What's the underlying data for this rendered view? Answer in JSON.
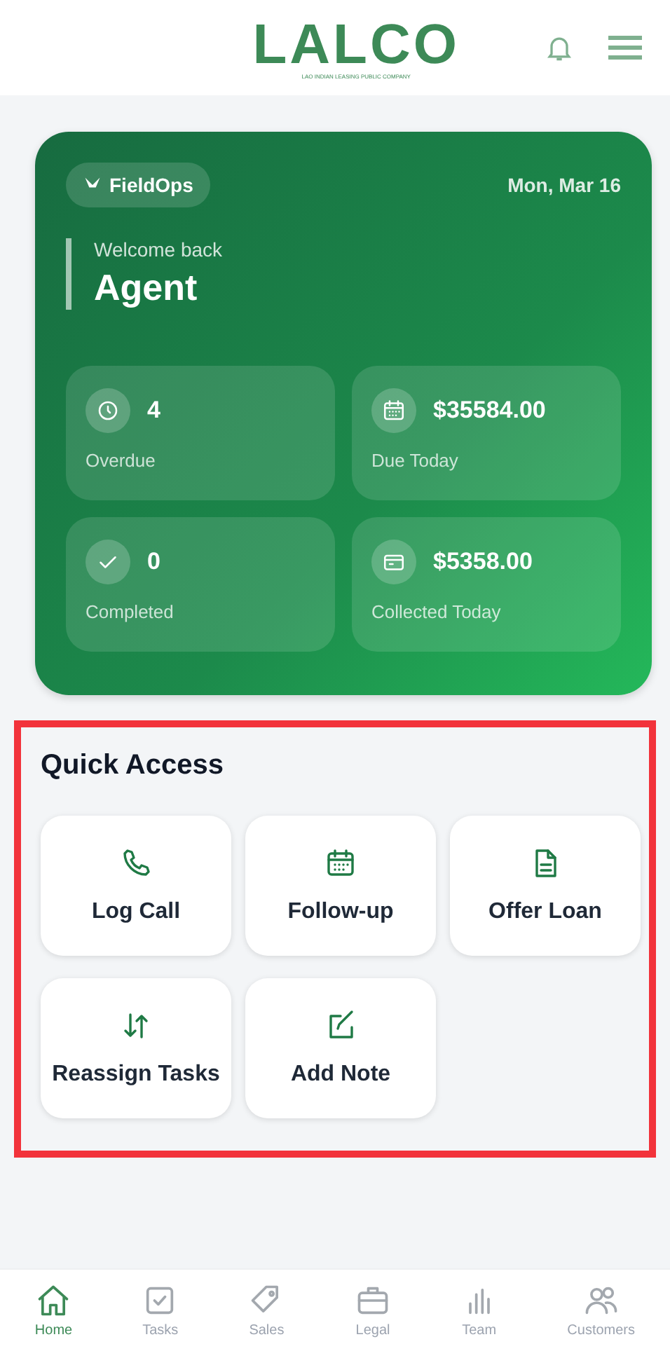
{
  "header": {
    "logo": "LALCO",
    "tagline": "LAO INDIAN LEASING PUBLIC COMPANY"
  },
  "hero": {
    "badge": "FieldOps",
    "date": "Mon, Mar 16",
    "greeting": "Welcome back",
    "name": "Agent",
    "stats": [
      {
        "kind": "clock",
        "value": "4",
        "label": "Overdue"
      },
      {
        "kind": "calendar",
        "value": "$35584.00",
        "label": "Due Today"
      },
      {
        "kind": "check",
        "value": "0",
        "label": "Completed"
      },
      {
        "kind": "wallet",
        "value": "$5358.00",
        "label": "Collected Today"
      }
    ]
  },
  "quick_access": {
    "title": "Quick Access",
    "highlighted": true,
    "items": [
      {
        "kind": "phone",
        "label": "Log Call"
      },
      {
        "kind": "calendar",
        "label": "Follow-up"
      },
      {
        "kind": "document",
        "label": "Offer Loan"
      },
      {
        "kind": "swap",
        "label": "Reassign Tasks"
      },
      {
        "kind": "edit",
        "label": "Add Note"
      }
    ]
  },
  "nav": [
    {
      "kind": "home",
      "label": "Home",
      "selected": true
    },
    {
      "kind": "tasks",
      "label": "Tasks",
      "selected": false
    },
    {
      "kind": "tag",
      "label": "Sales",
      "selected": false
    },
    {
      "kind": "briefcase",
      "label": "Legal",
      "selected": false
    },
    {
      "kind": "chart",
      "label": "Team",
      "selected": false
    },
    {
      "kind": "people",
      "label": "Customers",
      "selected": false
    }
  ]
}
